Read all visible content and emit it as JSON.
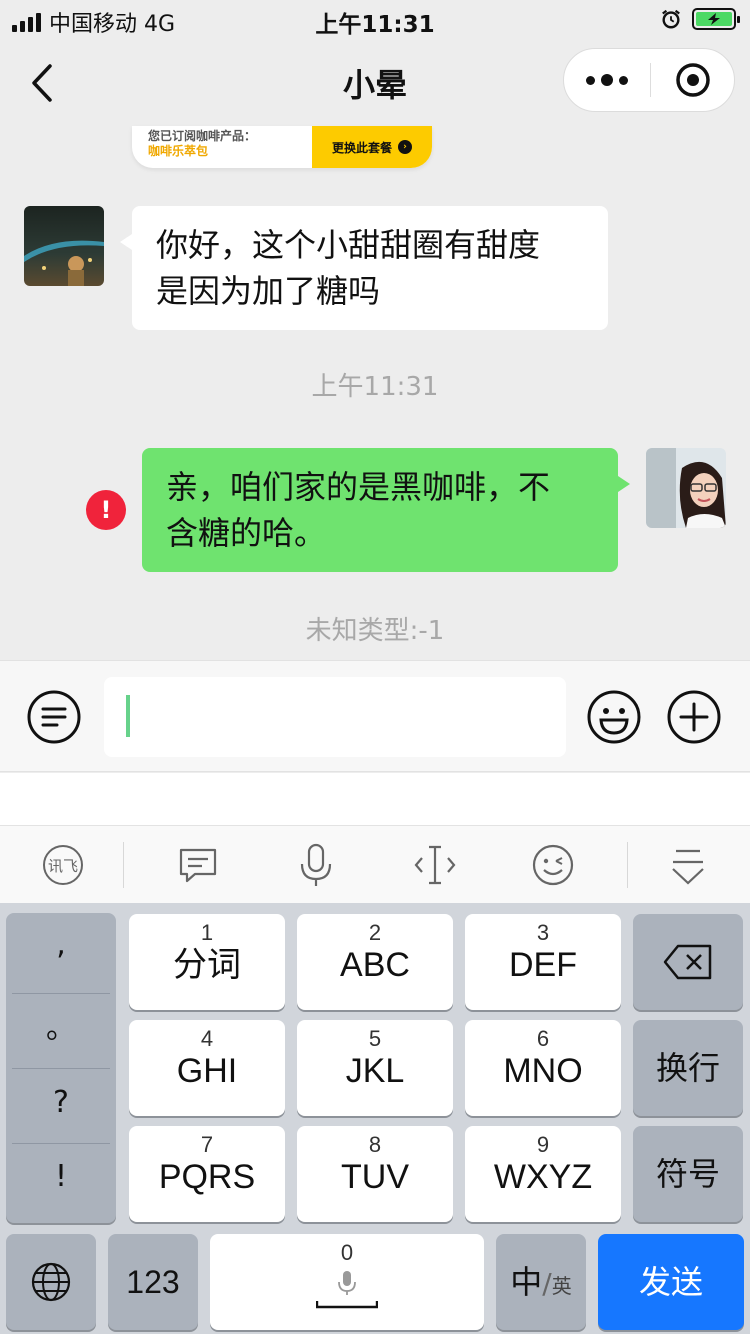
{
  "status_bar": {
    "carrier": "中国移动 4G",
    "time": "上午11:31",
    "battery_color": "#4cd964"
  },
  "nav": {
    "title": "小晕"
  },
  "banner": {
    "line1": "您已订阅咖啡产品：",
    "line2": "咖啡乐萃包",
    "button": "更换此套餐"
  },
  "messages": [
    {
      "direction": "in",
      "text_lines": [
        "你好，这个小甜甜圈有甜度",
        "是因为加了糖吗"
      ]
    },
    {
      "direction": "out",
      "text_lines": [
        "亲，咱们家的是黑咖啡，不",
        "含糖的哈。"
      ],
      "failed": true
    }
  ],
  "timestamp": "上午11:31",
  "unknown_type": "未知类型:-1",
  "input": {
    "value": ""
  },
  "keyboard": {
    "punct": [
      ",",
      "。",
      "?",
      "!"
    ],
    "keys": [
      {
        "num": "1",
        "label": "分词"
      },
      {
        "num": "2",
        "label": "ABC"
      },
      {
        "num": "3",
        "label": "DEF"
      },
      {
        "num": "4",
        "label": "GHI"
      },
      {
        "num": "5",
        "label": "JKL"
      },
      {
        "num": "6",
        "label": "MNO"
      },
      {
        "num": "7",
        "label": "PQRS"
      },
      {
        "num": "8",
        "label": "TUV"
      },
      {
        "num": "9",
        "label": "WXYZ"
      }
    ],
    "return_label": "换行",
    "symbol_label": "符号",
    "num_label": "123",
    "space_num": "0",
    "lang_main": "中",
    "lang_sub": "英",
    "send_label": "发送",
    "send_color": "#1677ff"
  },
  "colors": {
    "out_bubble": "#6fe36f",
    "error": "#f0233b",
    "banner_button": "#fdcb00"
  }
}
